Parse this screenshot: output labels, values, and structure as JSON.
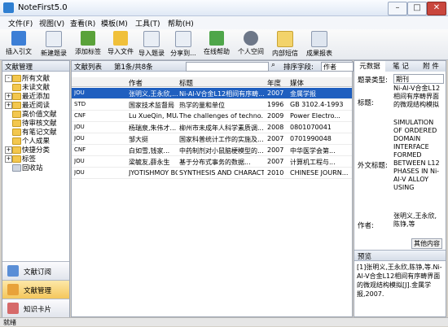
{
  "window": {
    "title": "NoteFirst5.0",
    "min": "–",
    "max": "□",
    "close": "✕"
  },
  "menu": [
    "文件(F)",
    "视图(V)",
    "查看(R)",
    "模板(M)",
    "工具(T)",
    "帮助(H)"
  ],
  "toolbar": [
    "插入引文",
    "新建题录",
    "添加标签",
    "导入文件",
    "导入题录",
    "分享到...",
    "在线帮助",
    "个人空间",
    "内部短信",
    "成果报表"
  ],
  "left": {
    "header": "文献管理",
    "tree": [
      "所有文献",
      "未读文献",
      "最近添加",
      "最近阅读",
      "高价值文献",
      "待审核文献",
      "有笔记文献",
      "个人成果",
      "快捷分类",
      "标签",
      "回收站"
    ],
    "nav": [
      "文献订阅",
      "文献管理",
      "知识卡片"
    ]
  },
  "center": {
    "list_label": "文献列表",
    "page_info": "第1条/共8条",
    "sort_label": "排序字段:",
    "sort_value": "作者",
    "columns": [
      "作者",
      "标题",
      "年度",
      "媒体"
    ],
    "rows": [
      {
        "author": "张明义,王永欣,...",
        "title": "Ni-Al-V合金L12相间有序畴...",
        "year": "2007",
        "media": "金属学报",
        "type": "JOU"
      },
      {
        "author": "国家技术监督局",
        "title": "热学的量和单位",
        "year": "1996",
        "media": "GB 3102.4-1993",
        "type": "STD"
      },
      {
        "author": "Lu XueQin, MUA...",
        "title": "The challenges of techno...",
        "year": "2009",
        "media": "Power Electro...",
        "type": "CNF"
      },
      {
        "author": "杨瑞泉,朱伟才...",
        "title": "柳州市未成年人科学素质调...",
        "year": "2008",
        "media": "0801070041",
        "type": "JOU"
      },
      {
        "author": "邹大挺",
        "title": "国家科普统计工作的实施及...",
        "year": "2007",
        "media": "0701990048",
        "type": "JOU"
      },
      {
        "author": "白如雪,钱家...",
        "title": "中药制剂对小鼠脑梗模型的...",
        "year": "2007",
        "media": "中华医学会第...",
        "type": "CNF"
      },
      {
        "author": "梁毓友,薛永生",
        "title": "基于分布式事务的数据...",
        "year": "2007",
        "media": "计算机工程与...",
        "type": "JOU"
      },
      {
        "author": "JYOTISHMOY BO...",
        "title": "SYNTHESIS AND CHARACTERI...",
        "year": "2010",
        "media": "CHINESE JOURN...",
        "type": "JOU"
      }
    ]
  },
  "right": {
    "tabs": [
      "元数据",
      "笔 记",
      "附 件"
    ],
    "type_label": "题录类型:",
    "type_value": "期刊",
    "title_label": "标题:",
    "title_value": "Ni-Al-V合金L12相间有序畴界面的微观结构模拟",
    "alt_title_label": "外文标题:",
    "alt_title_value": "SIMULATION OF ORDERED DOMAIN INTERFACE FORMED BETWEEN L12 PHASES IN Ni-Al-V ALLOY USING",
    "author_label": "作者:",
    "author_value": "张明义,王永欣,陈铮,等",
    "more": "其他内容",
    "preview_label": "预览",
    "preview_text": "[1]张明义,王永欣,陈铮,等.Ni-Al-V合金L12相间有序畴界面的微观结构模拟[J].金属学报,2007."
  },
  "status": "就绪"
}
